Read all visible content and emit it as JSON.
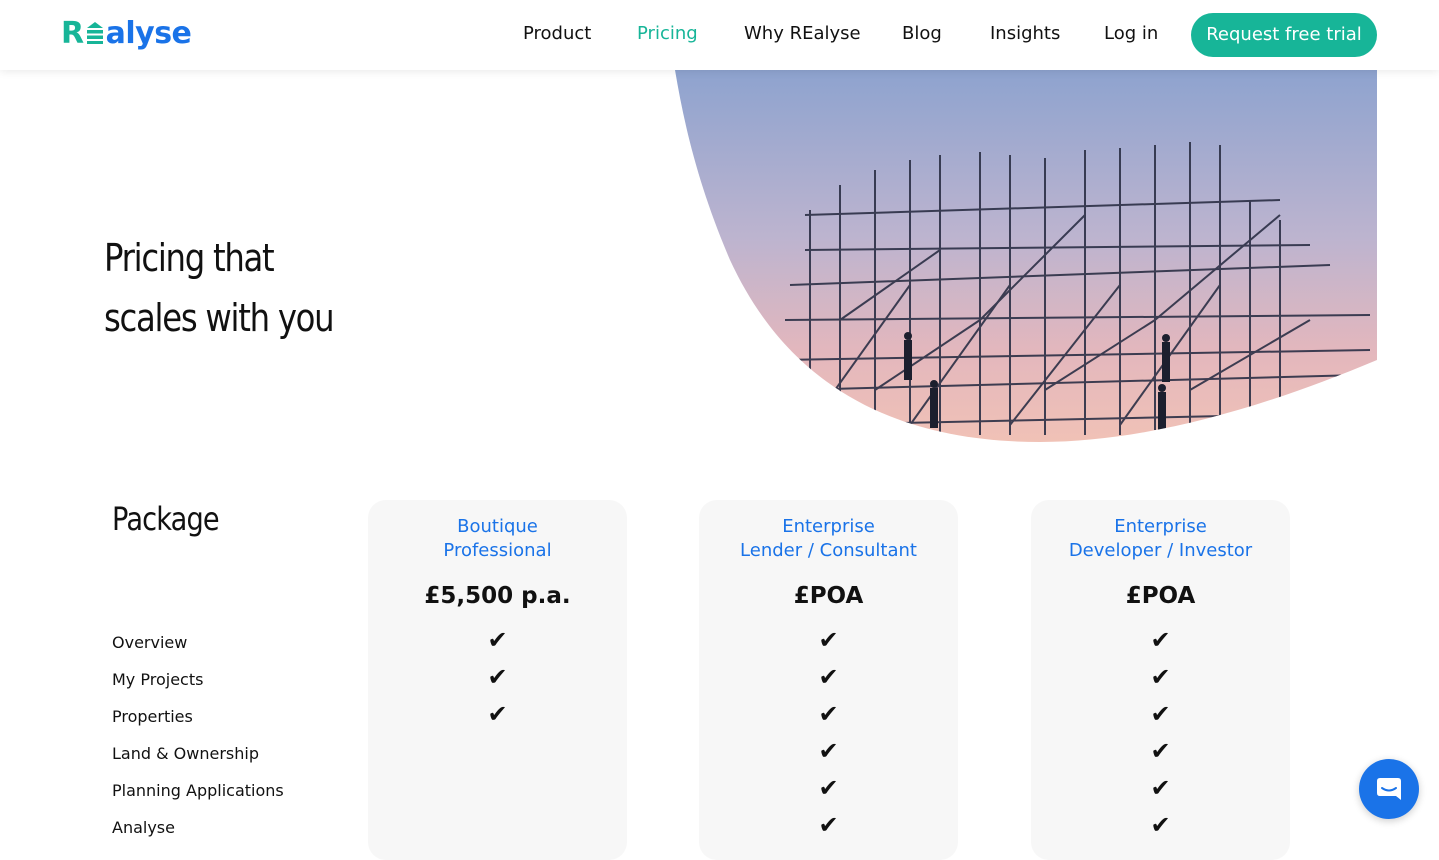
{
  "header": {
    "logo_text": {
      "first": "R",
      "rest": "alyse"
    },
    "nav": [
      {
        "label": "Product",
        "active": false
      },
      {
        "label": "Pricing",
        "active": true
      },
      {
        "label": "Why REalyse",
        "active": false
      },
      {
        "label": "Blog",
        "active": false
      },
      {
        "label": "Insights",
        "active": false
      },
      {
        "label": "Log in",
        "active": false
      }
    ],
    "cta_label": "Request free trial"
  },
  "hero": {
    "title_line1": "Pricing that",
    "title_line2": "scales with you"
  },
  "pricing": {
    "package_label": "Package",
    "plans": [
      {
        "name_line1": "Boutique",
        "name_line2": "Professional",
        "price": "£5,500 p.a."
      },
      {
        "name_line1": "Enterprise",
        "name_line2": "Lender / Consultant",
        "price": "£POA"
      },
      {
        "name_line1": "Enterprise",
        "name_line2": "Developer / Investor",
        "price": "£POA"
      }
    ],
    "check_glyph": "✔",
    "features": [
      {
        "label": "Overview",
        "included": [
          true,
          true,
          true
        ]
      },
      {
        "label": "My Projects",
        "included": [
          true,
          true,
          true
        ]
      },
      {
        "label": "Properties",
        "included": [
          true,
          true,
          true
        ]
      },
      {
        "label": "Land & Ownership",
        "included": [
          false,
          true,
          true
        ]
      },
      {
        "label": "Planning Applications",
        "included": [
          false,
          true,
          true
        ]
      },
      {
        "label": "Analyse",
        "included": [
          false,
          true,
          true
        ]
      }
    ]
  },
  "colors": {
    "brand_green": "#17b598",
    "brand_blue": "#1a73e8",
    "card_bg": "#f7f7f7"
  },
  "icons": {
    "chat": "chat-bubble-icon",
    "logo_mark": "building-bars-icon"
  }
}
